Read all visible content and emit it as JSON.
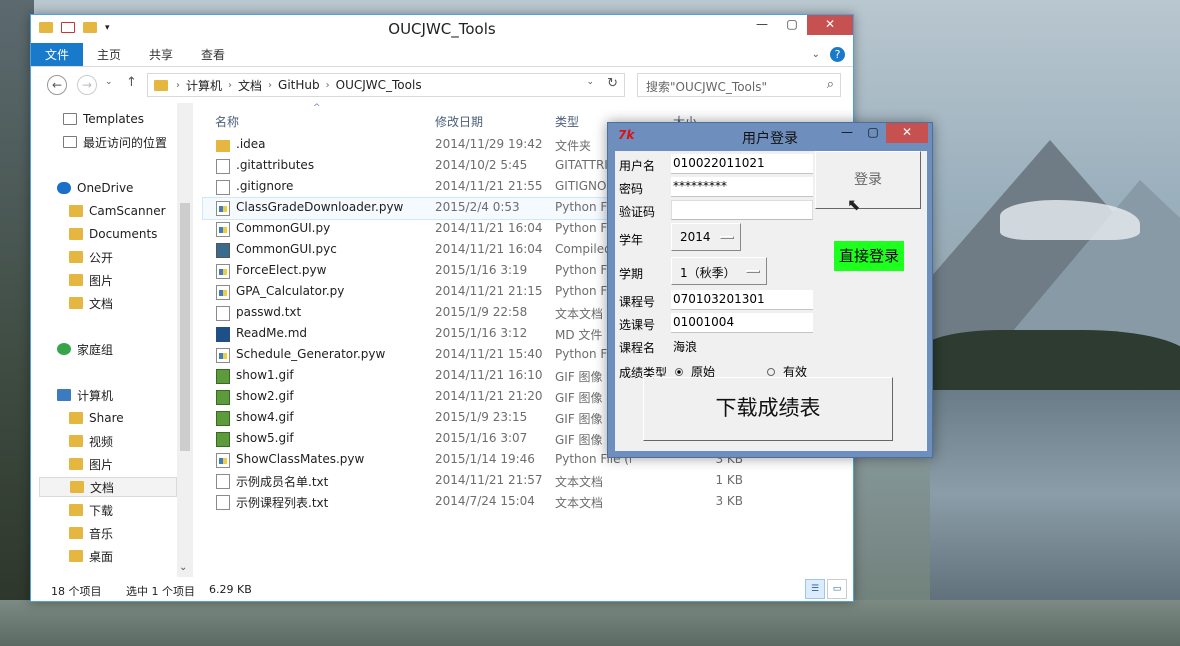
{
  "desktop": {
    "labels": [
      "",
      "",
      ""
    ]
  },
  "explorer": {
    "title": "OUCJWC_Tools",
    "ribbon_tabs": [
      "文件",
      "主页",
      "共享",
      "查看"
    ],
    "help_label": "?",
    "breadcrumb": [
      "计算机",
      "文档",
      "GitHub",
      "OUCJWC_Tools"
    ],
    "search_placeholder": "搜索\"OUCJWC_Tools\"",
    "nav": {
      "templates": "Templates",
      "recent": "最近访问的位置",
      "onedrive": "OneDrive",
      "camscanner": "CamScanner",
      "documents": "Documents",
      "public": "公开",
      "pictures_od": "图片",
      "docs_od": "文档",
      "homegroup": "家庭组",
      "computer": "计算机",
      "share": "Share",
      "videos": "视频",
      "pictures": "图片",
      "docs": "文档",
      "downloads": "下载",
      "music": "音乐",
      "desktop": "桌面"
    },
    "columns": {
      "name": "名称",
      "date": "修改日期",
      "type": "类型",
      "size": "大小"
    },
    "files": [
      {
        "name": ".idea",
        "date": "2014/11/29 19:42",
        "type": "文件夹",
        "size": "",
        "icon": "folder"
      },
      {
        "name": ".gitattributes",
        "date": "2014/10/2 5:45",
        "type": "GITATTRIBUTES",
        "size": "",
        "icon": "doc"
      },
      {
        "name": ".gitignore",
        "date": "2014/11/21 21:55",
        "type": "GITIGNORE",
        "size": "",
        "icon": "doc"
      },
      {
        "name": "ClassGradeDownloader.pyw",
        "date": "2015/2/4 0:53",
        "type": "Python File",
        "size": "",
        "icon": "py"
      },
      {
        "name": "CommonGUI.py",
        "date": "2014/11/21 16:04",
        "type": "Python File",
        "size": "",
        "icon": "py"
      },
      {
        "name": "CommonGUI.pyc",
        "date": "2014/11/21 16:04",
        "type": "Compiled",
        "size": "",
        "icon": "pyc"
      },
      {
        "name": "ForceElect.pyw",
        "date": "2015/1/16 3:19",
        "type": "Python File",
        "size": "",
        "icon": "py"
      },
      {
        "name": "GPA_Calculator.py",
        "date": "2014/11/21 21:15",
        "type": "Python File",
        "size": "",
        "icon": "py"
      },
      {
        "name": "passwd.txt",
        "date": "2015/1/9 22:58",
        "type": "文本文档",
        "size": "",
        "icon": "doc"
      },
      {
        "name": "ReadMe.md",
        "date": "2015/1/16 3:12",
        "type": "MD 文件",
        "size": "",
        "icon": "md"
      },
      {
        "name": "Schedule_Generator.pyw",
        "date": "2014/11/21 15:40",
        "type": "Python File",
        "size": "",
        "icon": "py"
      },
      {
        "name": "show1.gif",
        "date": "2014/11/21 16:10",
        "type": "GIF 图像",
        "size": "",
        "icon": "gif"
      },
      {
        "name": "show2.gif",
        "date": "2014/11/21 21:20",
        "type": "GIF 图像",
        "size": "",
        "icon": "gif"
      },
      {
        "name": "show4.gif",
        "date": "2015/1/9 23:15",
        "type": "GIF 图像",
        "size": "",
        "icon": "gif"
      },
      {
        "name": "show5.gif",
        "date": "2015/1/16 3:07",
        "type": "GIF 图像",
        "size": "",
        "icon": "gif"
      },
      {
        "name": "ShowClassMates.pyw",
        "date": "2015/1/14 19:46",
        "type": "Python File (no c...",
        "size": "3 KB",
        "icon": "py"
      },
      {
        "name": "示例成员名单.txt",
        "date": "2014/11/21 21:57",
        "type": "文本文档",
        "size": "1 KB",
        "icon": "doc"
      },
      {
        "name": "示例课程列表.txt",
        "date": "2014/7/24 15:04",
        "type": "文本文档",
        "size": "3 KB",
        "icon": "doc"
      }
    ],
    "status": {
      "count": "18 个项目",
      "selected": "选中 1 个项目",
      "selected_size": "6.29 KB"
    }
  },
  "tk": {
    "logo": "7k",
    "title": "用户登录",
    "labels": {
      "username": "用户名",
      "password": "密码",
      "captcha": "验证码",
      "year": "学年",
      "term": "学期",
      "course_no": "课程号",
      "select_no": "选课号",
      "course_name": "课程名",
      "grade_type": "成绩类型"
    },
    "values": {
      "username": "010022011021",
      "password": "*********",
      "captcha": "",
      "year": "2014",
      "term": "1（秋季）",
      "course_no": "070103201301",
      "select_no": "01001004",
      "course_name": "海浪"
    },
    "login_button": "登录",
    "direct_login_button": "直接登录",
    "radio_original": "原始",
    "radio_valid": "有效",
    "download_button": "下载成绩表",
    "colors": {
      "direct_login_bg": "#1dff1d",
      "close_bg": "#c75050"
    }
  }
}
